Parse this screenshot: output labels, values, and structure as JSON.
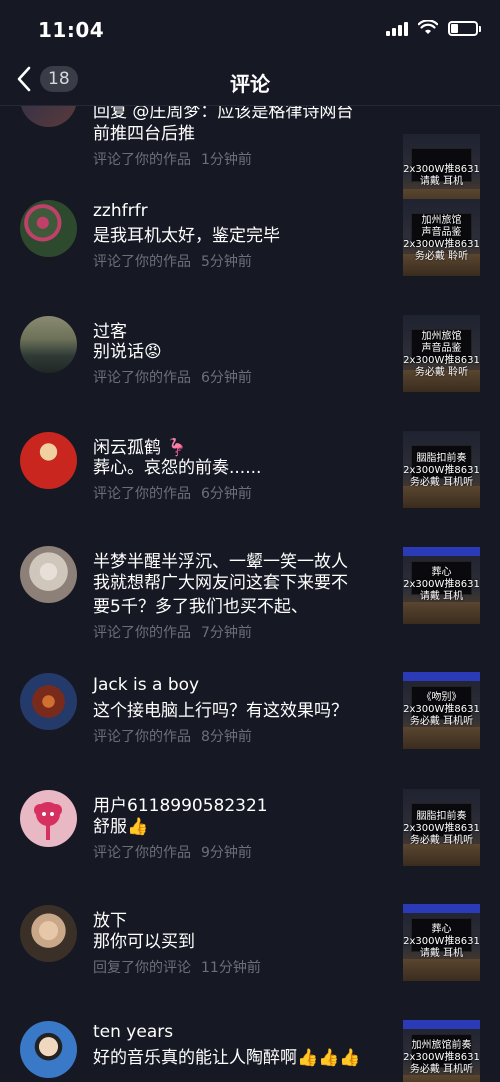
{
  "status": {
    "time": "11:04"
  },
  "nav": {
    "badge": "18",
    "title": "评论"
  },
  "items": [
    {
      "name": "",
      "comment": "回复 @庄周梦：应该是格律诗网台",
      "comment2": "前推四台后推",
      "meta_action": "评论了你的作品",
      "meta_time": "1分钟前",
      "thumb_text": [
        "请戴",
        "2x300W推8631",
        "耳机"
      ],
      "avatar_colors": [
        "#2a2f4a",
        "#5a3a3a"
      ]
    },
    {
      "name": "zzhfrfr",
      "comment": "是我耳机太好，鉴定完毕",
      "meta_action": "评论了你的作品",
      "meta_time": "5分钟前",
      "thumb_text": [
        "加州旅馆",
        "声音品鉴",
        "2x300W推8631",
        "务必戴 聆听"
      ],
      "avatar_colors": [
        "#3e5a3a",
        "#c0406a"
      ]
    },
    {
      "name": "过客",
      "comment": "别说话",
      "emoji": "😡",
      "meta_action": "评论了你的作品",
      "meta_time": "6分钟前",
      "thumb_text": [
        "加州旅馆",
        "声音品鉴",
        "2x300W推8631",
        "务必戴 聆听"
      ],
      "avatar_colors": [
        "#6d7258",
        "#2f3a36"
      ]
    },
    {
      "name": "闲云孤鹤",
      "name_emoji": "🦩",
      "comment": "葬心。哀怨的前奏......",
      "meta_action": "评论了你的作品",
      "meta_time": "6分钟前",
      "thumb_text": [
        "胭脂扣前奏",
        "2x300W推8631",
        "务必戴 耳机听"
      ],
      "avatar_colors": [
        "#c8261e",
        "#f0d0a0"
      ]
    },
    {
      "name": "半梦半醒半浮沉、一颦一笑一故人",
      "comment": "我就想帮广大网友问这套下来要不",
      "comment2": "要5千？多了我们也买不起、",
      "meta_action": "评论了你的作品",
      "meta_time": "7分钟前",
      "thumb_text": [
        "葬心",
        "2x300W推8631",
        "请戴 耳机"
      ],
      "avatar_colors": [
        "#cfc6bc",
        "#8c8078"
      ]
    },
    {
      "name": "Jack is a boy",
      "comment": "这个接电脑上行吗？有这效果吗？",
      "meta_action": "评论了你的作品",
      "meta_time": "8分钟前",
      "thumb_text": [
        "《吻别》",
        "2x300W推8631",
        "务必戴 耳机听"
      ],
      "avatar_colors": [
        "#7a2a1a",
        "#243a6a"
      ]
    },
    {
      "name": "用户6118990582321",
      "comment": "舒服",
      "emoji": "👍",
      "meta_action": "评论了你的作品",
      "meta_time": "9分钟前",
      "thumb_text": [
        "胭脂扣前奏",
        "2x300W推8631",
        "务必戴 耳机听"
      ],
      "avatar_colors": [
        "#e8b8c4",
        "#d63060"
      ]
    },
    {
      "name": "放下",
      "comment": "那你可以买到",
      "meta_action": "回复了你的评论",
      "meta_time": "11分钟前",
      "thumb_text": [
        "葬心",
        "2x300W推8631",
        "请戴 耳机"
      ],
      "avatar_colors": [
        "#c8a888",
        "#3a3028"
      ]
    },
    {
      "name": "ten years",
      "comment": "好的音乐真的能让人陶醉啊",
      "emoji": "👍👍👍",
      "meta_action": "",
      "meta_time": "",
      "thumb_text": [
        "加州旅馆前奏",
        "2x300W推8631",
        "务必戴 耳机听"
      ],
      "avatar_colors": [
        "#3a78c8",
        "#f0d8c0"
      ]
    }
  ]
}
